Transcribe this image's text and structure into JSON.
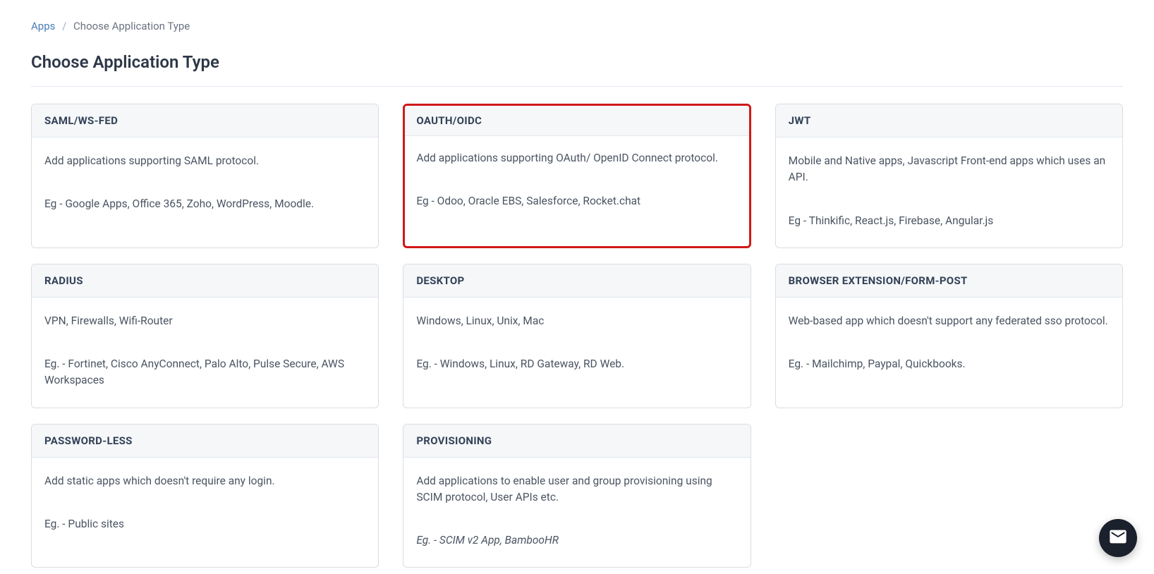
{
  "breadcrumb": {
    "parent": "Apps",
    "current": "Choose Application Type"
  },
  "page_title": "Choose Application Type",
  "cards": [
    {
      "title": "SAML/WS-FED",
      "description": "Add applications supporting SAML protocol.",
      "examples": "Eg - Google Apps, Office 365, Zoho, WordPress, Moodle.",
      "highlighted": false,
      "examples_italic": false
    },
    {
      "title": "OAUTH/OIDC",
      "description": "Add applications supporting OAuth/ OpenID Connect protocol.",
      "examples": "Eg - Odoo, Oracle EBS, Salesforce, Rocket.chat",
      "highlighted": true,
      "examples_italic": false
    },
    {
      "title": "JWT",
      "description": "Mobile and Native apps, Javascript Front-end apps which uses an API.",
      "examples": "Eg - Thinkific, React.js, Firebase, Angular.js",
      "highlighted": false,
      "examples_italic": false
    },
    {
      "title": "RADIUS",
      "description": "VPN, Firewalls, Wifi-Router",
      "examples": "Eg. - Fortinet, Cisco AnyConnect, Palo Alto, Pulse Secure, AWS Workspaces",
      "highlighted": false,
      "examples_italic": false
    },
    {
      "title": "DESKTOP",
      "description": "Windows, Linux, Unix, Mac",
      "examples": "Eg. - Windows, Linux, RD Gateway, RD Web.",
      "highlighted": false,
      "examples_italic": false
    },
    {
      "title": "BROWSER EXTENSION/FORM-POST",
      "description": "Web-based app which doesn't support any federated sso protocol.",
      "examples": "Eg. - Mailchimp, Paypal, Quickbooks.",
      "highlighted": false,
      "examples_italic": false
    },
    {
      "title": "PASSWORD-LESS",
      "description": "Add static apps which doesn't require any login.",
      "examples": "Eg. - Public sites",
      "highlighted": false,
      "examples_italic": false
    },
    {
      "title": "PROVISIONING",
      "description": "Add applications to enable user and group provisioning using SCIM protocol, User APIs etc.",
      "examples": "Eg. - SCIM v2 App, BambooHR",
      "highlighted": false,
      "examples_italic": true
    }
  ]
}
